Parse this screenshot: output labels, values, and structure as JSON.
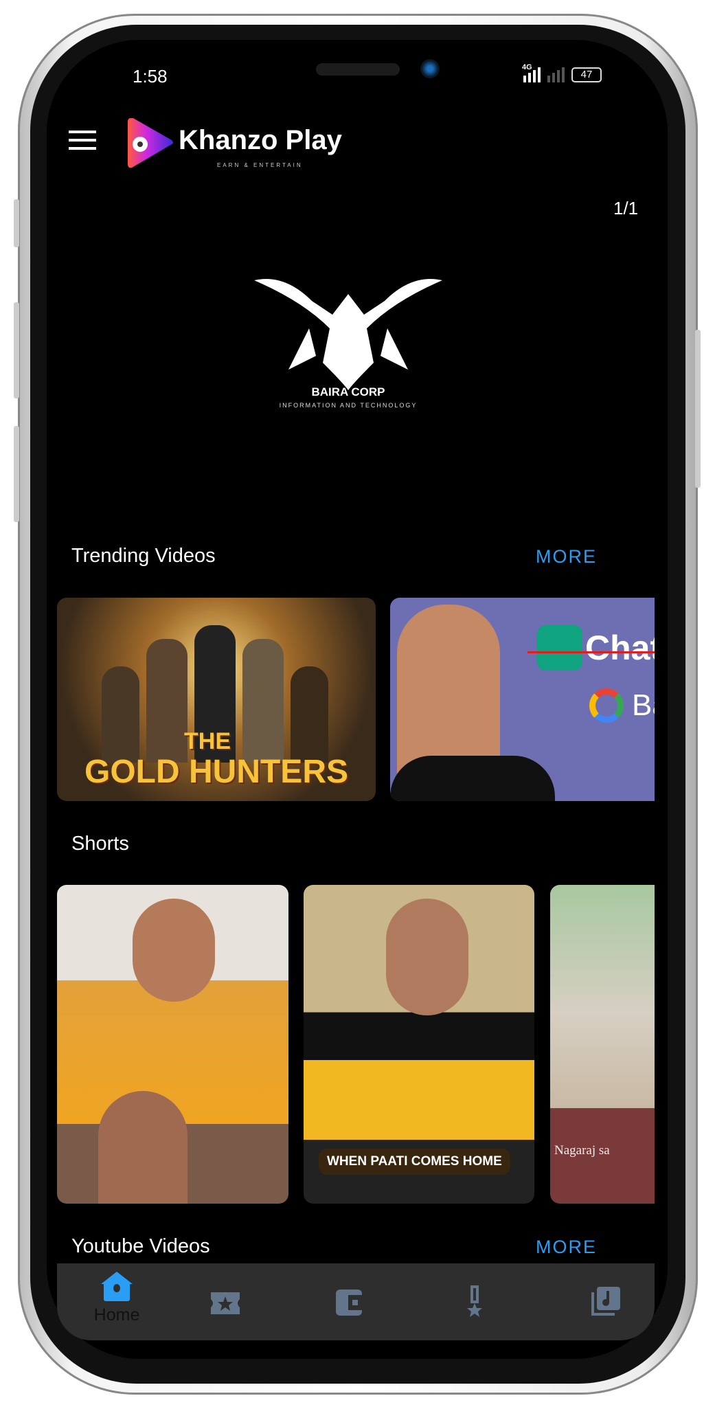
{
  "status_bar": {
    "time": "1:58",
    "network": "4G",
    "signal_icon": "signal-icon",
    "battery": "47"
  },
  "header": {
    "app_name": "Khanzo Play",
    "tagline": "EARN & ENTERTAIN",
    "menu_icon": "hamburger-icon"
  },
  "banner": {
    "counter": "1/1",
    "brand": "BAIRA CORP",
    "brand_sub": "INFORMATION AND TECHNOLOGY"
  },
  "trending": {
    "title": "Trending Videos",
    "more": "MORE",
    "items": [
      {
        "overlay": "THE GOLD HUNTERS",
        "title_top": "THE",
        "title_bottom": "GOLD HUNTERS"
      },
      {
        "overlay": "Chat",
        "sub": "Ba"
      }
    ]
  },
  "shorts": {
    "title": "Shorts",
    "items": [
      {
        "caption": ""
      },
      {
        "caption": "WHEN PAATI COMES HOME"
      },
      {
        "caption": "Nagaraj sa"
      }
    ]
  },
  "youtube": {
    "title": "Youtube Videos",
    "more": "MORE"
  },
  "bottom_nav": {
    "items": [
      {
        "label": "Home",
        "icon": "home-icon",
        "active": true
      },
      {
        "icon": "ticket-star-icon"
      },
      {
        "icon": "wallet-icon"
      },
      {
        "icon": "medal-icon"
      },
      {
        "icon": "music-library-icon"
      }
    ],
    "active_color": "#2a9df4",
    "inactive_color": "#62758a"
  }
}
